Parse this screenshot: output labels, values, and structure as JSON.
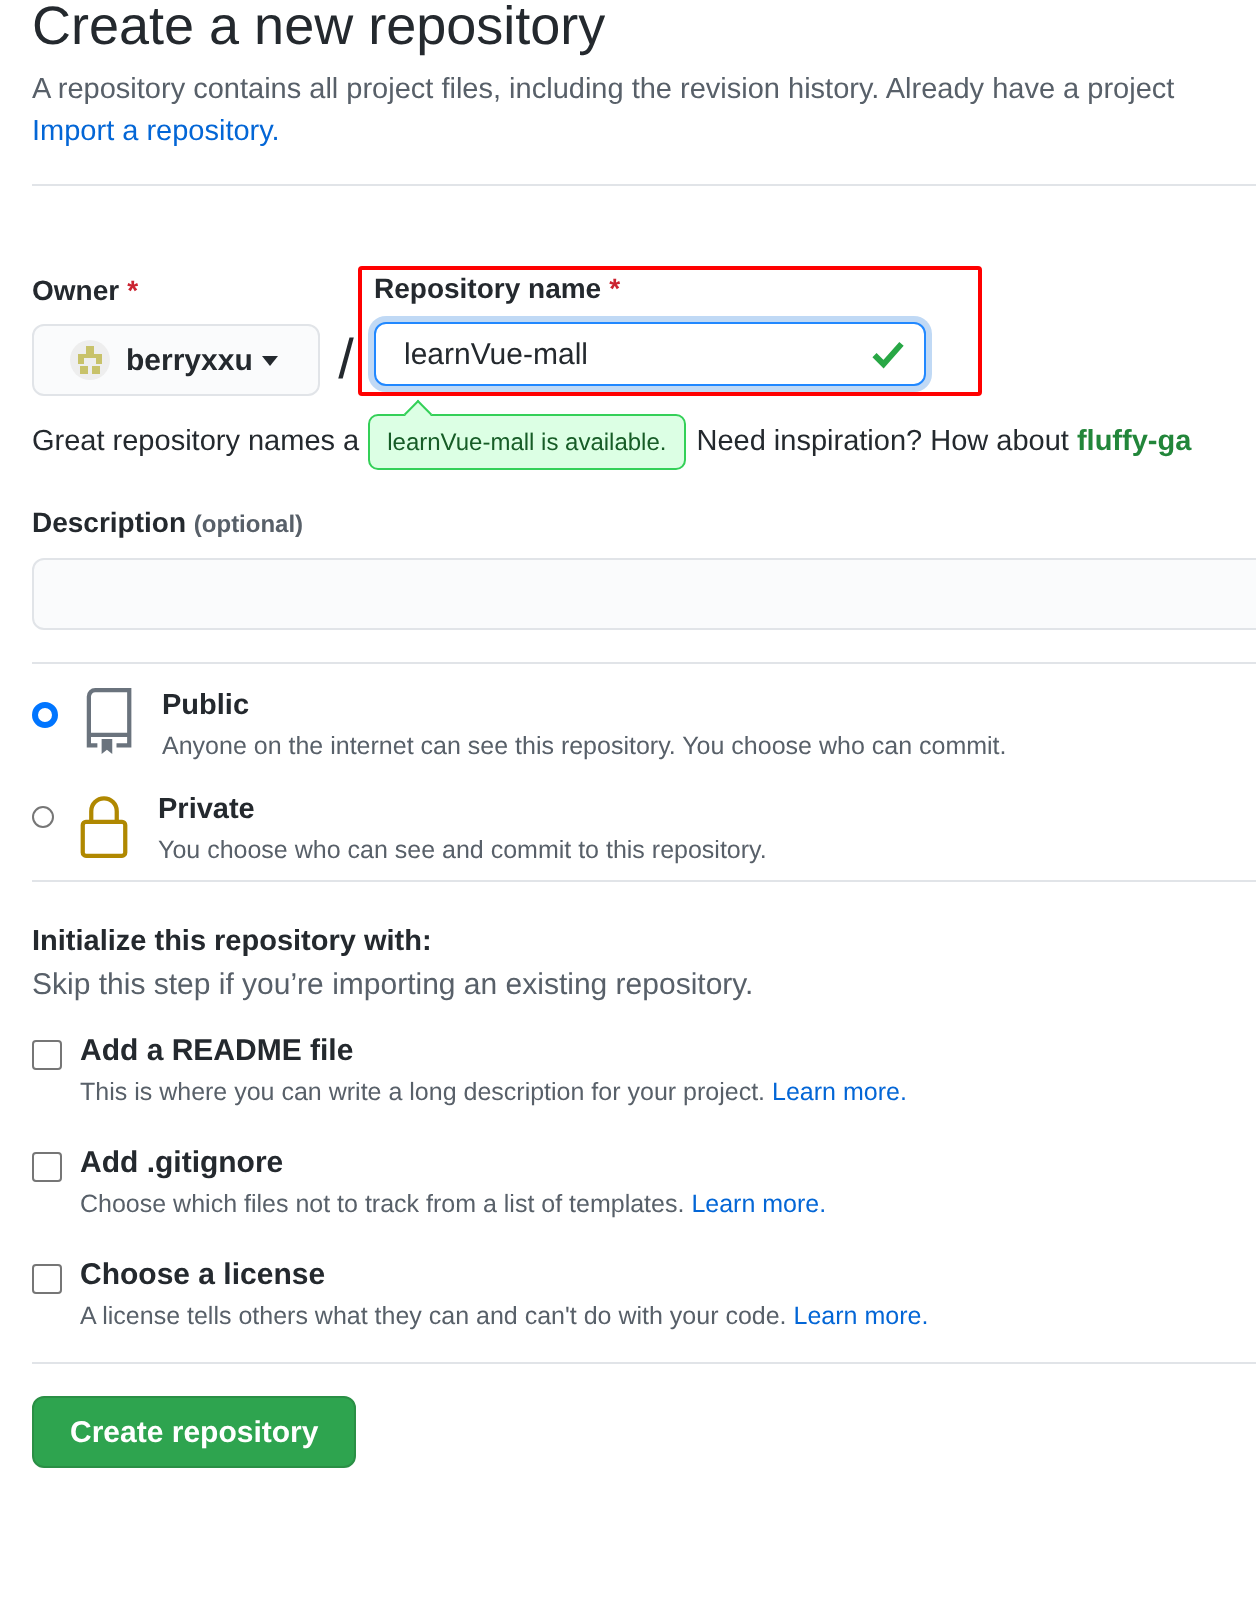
{
  "title": "Create a new repository",
  "subtitle": "A repository contains all project files, including the revision history. Already have a project",
  "import_link": "Import a repository.",
  "owner": {
    "label": "Owner",
    "required_mark": "*",
    "value": "berryxxu"
  },
  "separator": "/",
  "repository_name": {
    "label": "Repository name",
    "required_mark": "*",
    "value": "learnVue-mall",
    "valid": true,
    "highlighted": true
  },
  "hint": {
    "before": "Great repository names a",
    "tooltip": "learnVue-mall is available.",
    "after": "Need inspiration? How about",
    "suggestion": "fluffy-ga"
  },
  "description": {
    "label": "Description",
    "note": "(optional)"
  },
  "visibility": [
    {
      "kind": "public",
      "label": "Public",
      "text": "Anyone on the internet can see this repository. You choose who can commit.",
      "selected": true
    },
    {
      "kind": "private",
      "label": "Private",
      "text": "You choose who can see and commit to this repository.",
      "selected": false
    }
  ],
  "initialize": {
    "title": "Initialize this repository with:",
    "subtitle": "Skip this step if you’re importing an existing repository.",
    "options": [
      {
        "label": "Add a README file",
        "text": "This is where you can write a long description for your project.",
        "link": "Learn more.",
        "checked": false
      },
      {
        "label": "Add .gitignore",
        "text": "Choose which files not to track from a list of templates.",
        "link": "Learn more.",
        "checked": false
      },
      {
        "label": "Choose a license",
        "text": "A license tells others what they can and can't do with your code.",
        "link": "Learn more.",
        "checked": false
      }
    ]
  },
  "submit": "Create repository"
}
